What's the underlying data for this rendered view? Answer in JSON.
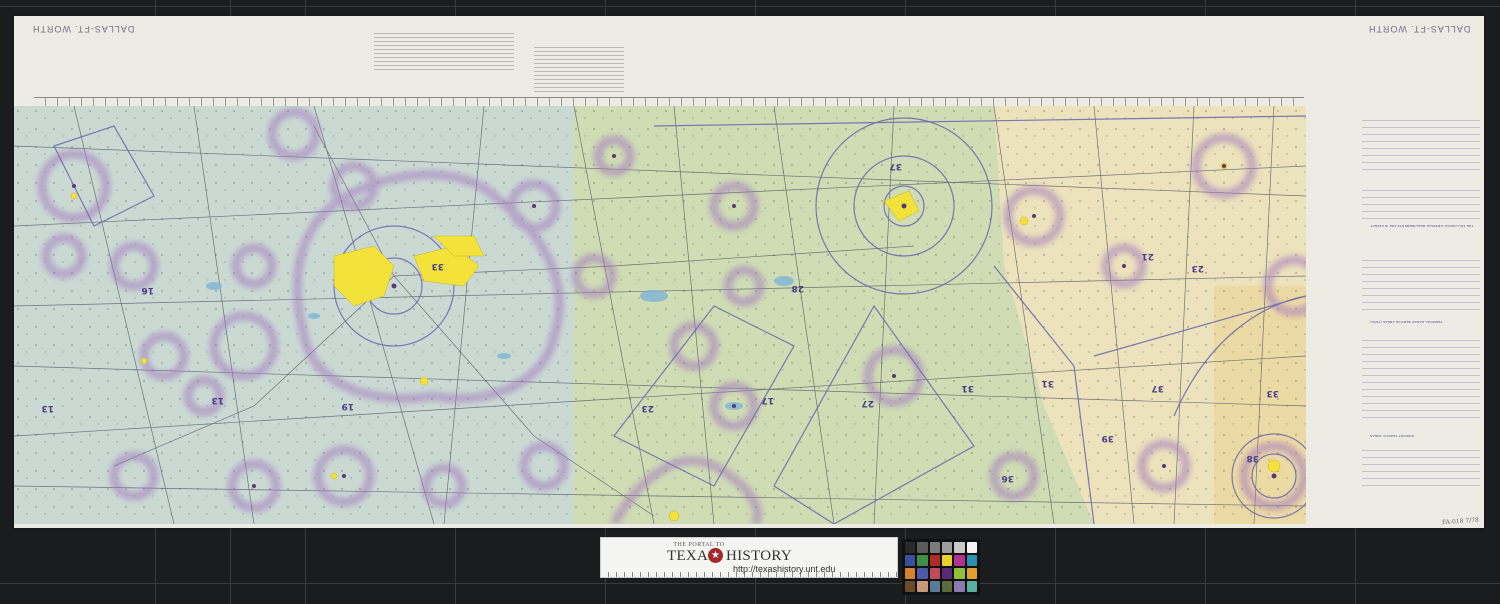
{
  "sheet": {
    "margin_title_left": "DALLAS-FT. WORTH",
    "margin_title_right": "DALLAS-FT. WORTH",
    "handwritten_note": "FA-018 7/78"
  },
  "map": {
    "background_colors": {
      "green_zone": "#cfdcb4",
      "tan_zone": "#ece2bb",
      "blue_zone": "#c9d9d6",
      "urban_yellow": "#f2e23a",
      "airspace_magenta": "#9a6fb6",
      "airspace_blue": "#6f6bb0",
      "road_dark": "#4a4f60",
      "water_blue": "#7db4d8"
    },
    "airspace_labels": [
      "33",
      "37",
      "16",
      "13",
      "13",
      "19",
      "23",
      "27",
      "17",
      "36",
      "21",
      "31",
      "37",
      "23",
      "33",
      "28",
      "38",
      "39",
      "31"
    ]
  },
  "legend_panel": {
    "heading_one": "THE FOLLOWING AIRSPACE REQUIREMENTS ARE IN EFFECT",
    "heading_two": "TERMINAL RADAR SERVICE AREAS (TRSA)",
    "heading_three": "AIRPORT TRAFFIC AREAS"
  },
  "ruler": {
    "portal_to": "THE PORTAL TO",
    "brand_left": "TEXAS",
    "brand_right": "HISTORY",
    "url": "http://texashistory.unt.edu"
  },
  "color_card": {
    "swatches": [
      "#2a2a2a",
      "#5a5a5a",
      "#7a7a7a",
      "#9d9d9d",
      "#c8c8c8",
      "#f2f2f2",
      "#3b4fa1",
      "#3f8f45",
      "#b12a2a",
      "#e8d22a",
      "#b2328f",
      "#2a8fb0",
      "#d6822a",
      "#4a5aa8",
      "#c04a5a",
      "#5a2a7a",
      "#8fc03a",
      "#e0a02a",
      "#6b4a2a",
      "#c89a7a",
      "#5a7a9a",
      "#5a6a3a",
      "#8a7ab0",
      "#5ab0a0"
    ]
  }
}
